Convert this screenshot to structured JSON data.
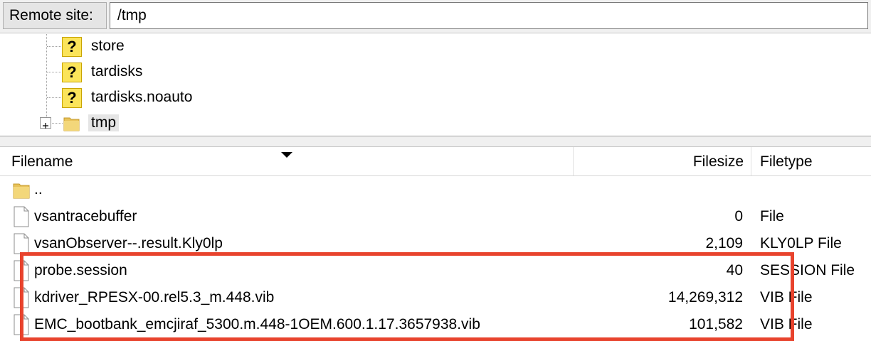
{
  "remote_site": {
    "label": "Remote site:",
    "path": "/tmp"
  },
  "tree": {
    "items": [
      {
        "label": "store",
        "icon": "unknown-folder-icon"
      },
      {
        "label": "tardisks",
        "icon": "unknown-folder-icon"
      },
      {
        "label": "tardisks.noauto",
        "icon": "unknown-folder-icon"
      },
      {
        "label": "tmp",
        "icon": "folder-icon",
        "expandable": true,
        "selected": true
      }
    ]
  },
  "file_list": {
    "columns": {
      "name": "Filename",
      "size": "Filesize",
      "type": "Filetype"
    },
    "rows": [
      {
        "name": "..",
        "size": "",
        "type": "",
        "icon": "folder-icon"
      },
      {
        "name": "vsantracebuffer",
        "size": "0",
        "type": "File",
        "icon": "file-icon"
      },
      {
        "name": "vsanObserver--.result.Kly0lp",
        "size": "2,109",
        "type": "KLY0LP File",
        "icon": "file-icon"
      },
      {
        "name": "probe.session",
        "size": "40",
        "type": "SESSION File",
        "icon": "file-icon"
      },
      {
        "name": "kdriver_RPESX-00.rel5.3_m.448.vib",
        "size": "14,269,312",
        "type": "VIB File",
        "icon": "file-icon"
      },
      {
        "name": "EMC_bootbank_emcjiraf_5300.m.448-1OEM.600.1.17.3657938.vib",
        "size": "101,582",
        "type": "VIB File",
        "icon": "file-icon"
      }
    ]
  },
  "colors": {
    "highlight": "#e8432d",
    "folder": "#e8c25a",
    "unknown": "#fbe45a"
  }
}
